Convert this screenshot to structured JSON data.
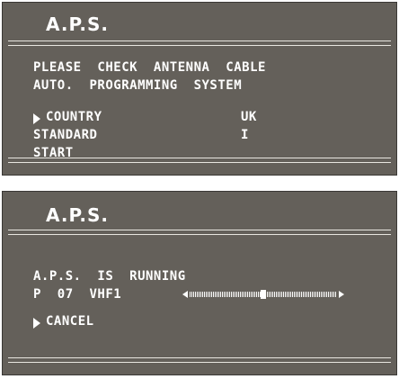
{
  "aps_top": {
    "title": "A.P.S.",
    "message_line1": "PLEASE  CHECK  ANTENNA  CABLE",
    "message_line2": "AUTO.  PROGRAMMING  SYSTEM",
    "menu": [
      {
        "label": "COUNTRY",
        "value": "UK",
        "selected": true
      },
      {
        "label": "STANDARD",
        "value": "I",
        "selected": false
      },
      {
        "label": "START",
        "value": "",
        "selected": false
      }
    ]
  },
  "aps_bottom": {
    "title": "A.P.S.",
    "status_line": "A.P.S.  IS  RUNNING",
    "channel_line": "P  07  VHF1",
    "tuning_progress": 0.5,
    "cancel_label": "CANCEL"
  },
  "colors": {
    "panel_bg": "#64605a",
    "text": "#ffffff"
  }
}
